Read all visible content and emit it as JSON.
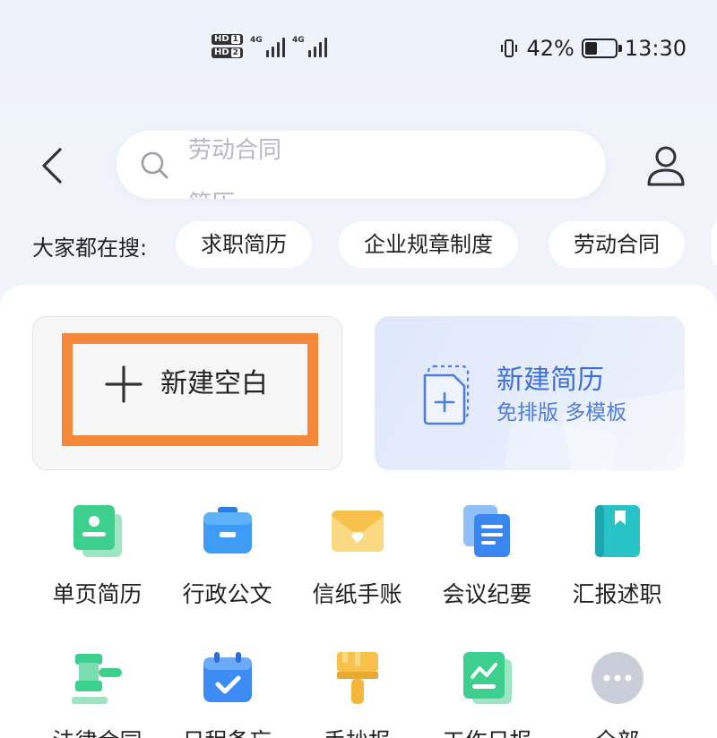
{
  "status": {
    "sim1": "HD",
    "sim1_num": "1",
    "sim2": "HD",
    "sim2_num": "2",
    "net1": "4G",
    "net2": "4G",
    "battery": "42%",
    "battery_level": 0.42,
    "time": "13:30"
  },
  "search": {
    "scroll_items": [
      "劳动合同",
      "简历"
    ]
  },
  "hot": {
    "label": "大家都在搜:",
    "chips": [
      "求职简历",
      "企业规章制度",
      "劳动合同"
    ]
  },
  "create": {
    "blank_label": "新建空白",
    "resume_title": "新建简历",
    "resume_sub": "免排版 多模板"
  },
  "templates": [
    {
      "label": "单页简历",
      "icon": "resume-page-icon",
      "color": "#3ccf8e"
    },
    {
      "label": "行政公文",
      "icon": "briefcase-icon",
      "color": "#3d9cf5"
    },
    {
      "label": "信纸手账",
      "icon": "envelope-heart-icon",
      "color": "#f7c14b"
    },
    {
      "label": "会议纪要",
      "icon": "document-stack-icon",
      "color": "#3a86f0"
    },
    {
      "label": "汇报述职",
      "icon": "bookmark-book-icon",
      "color": "#27c3c7"
    },
    {
      "label": "法律合同",
      "icon": "gavel-icon",
      "color": "#3ccf8e"
    },
    {
      "label": "日程备忘",
      "icon": "calendar-check-icon",
      "color": "#3d8cf5"
    },
    {
      "label": "手抄报",
      "icon": "paintbrush-icon",
      "color": "#f7c14b"
    },
    {
      "label": "工作日报",
      "icon": "report-chart-icon",
      "color": "#3ccf8e"
    },
    {
      "label": "全部",
      "icon": "more-icon",
      "color": "#c9ced8"
    }
  ]
}
